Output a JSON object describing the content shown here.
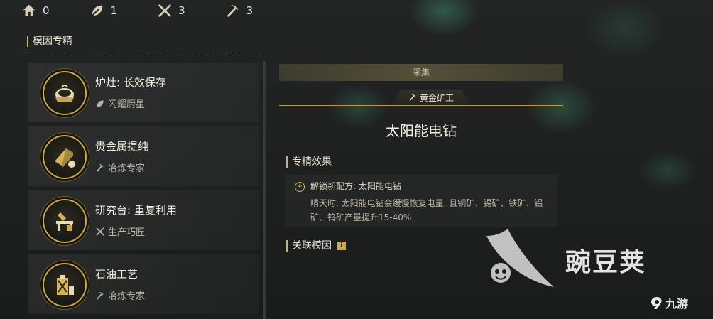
{
  "resources": [
    {
      "icon": "home-icon",
      "value": "0"
    },
    {
      "icon": "leaf-icon",
      "value": "1"
    },
    {
      "icon": "crossed-tools-icon",
      "value": "3"
    },
    {
      "icon": "pickaxe-icon",
      "value": "3"
    }
  ],
  "left": {
    "section_title": "模因专精",
    "genes": [
      {
        "name": "炉灶: 长效保存",
        "sub_icon": "leaf-icon",
        "sub": "闪耀厨星",
        "icon": "stove-icon"
      },
      {
        "name": "贵金属提纯",
        "sub_icon": "pickaxe-icon",
        "sub": "冶炼专家",
        "icon": "gold-bar-icon"
      },
      {
        "name": "研究台: 重复利用",
        "sub_icon": "crossed-tools-icon",
        "sub": "生产巧匠",
        "icon": "research-bench-icon"
      },
      {
        "name": "石油工艺",
        "sub_icon": "pickaxe-icon",
        "sub": "冶炼专家",
        "icon": "oil-can-icon"
      }
    ]
  },
  "detail": {
    "category": "采集",
    "job": "黄金矿工",
    "skill_name": "太阳能电钻",
    "effect_title": "专精效果",
    "effect_line1": "解锁新配方: 太阳能电钻",
    "effect_line2": "晴天时, 太阳能电钻会缓慢恢复电量, 且铜矿、锡矿、铁矿、铝矿、钨矿产量提升15-40%",
    "related_title": "关联模因",
    "related_info": "i"
  },
  "watermark": {
    "brand": "豌豆荚",
    "site": "九游"
  },
  "colors": {
    "accent": "#d4b35a",
    "background": "#1b1d1b"
  }
}
